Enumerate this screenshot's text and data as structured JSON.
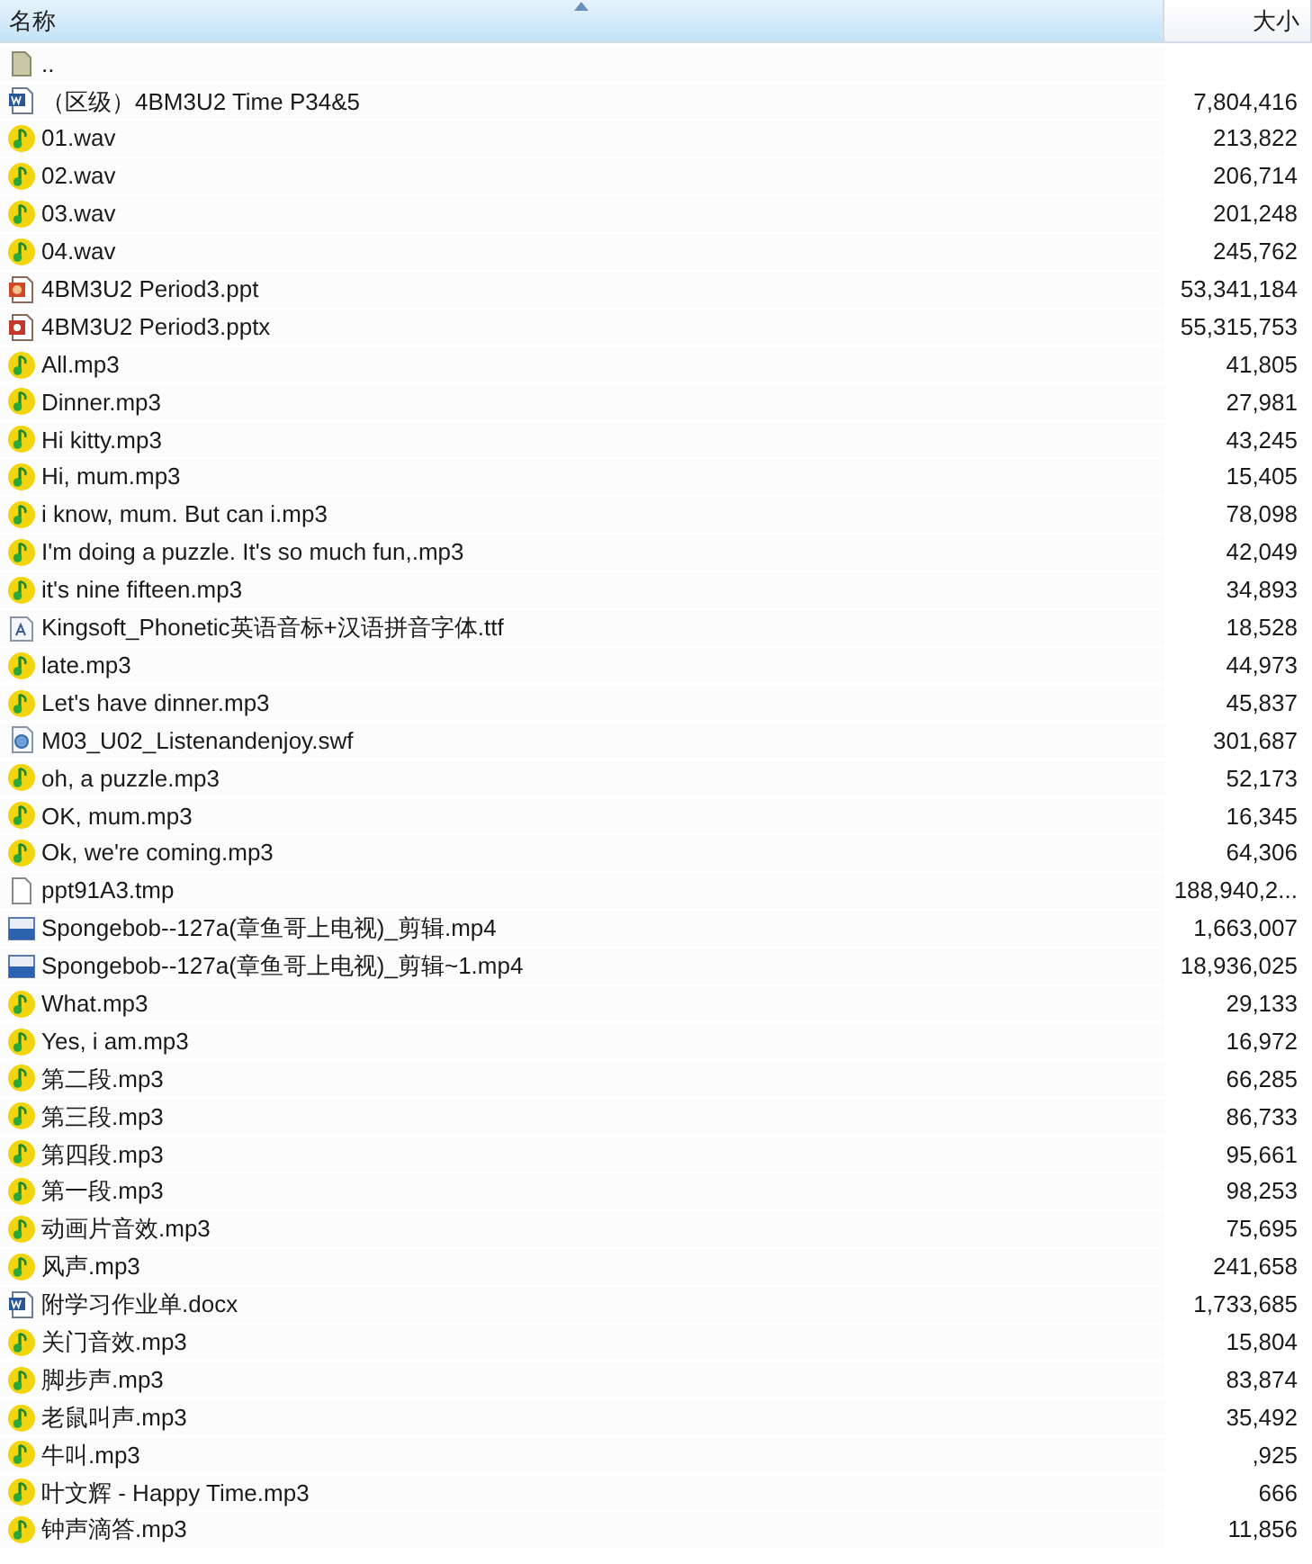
{
  "table": {
    "columns": [
      {
        "label": "名称",
        "sorted": true
      },
      {
        "label": "大小",
        "sorted": false
      }
    ],
    "rows": [
      {
        "kind": "folder",
        "name": "..",
        "size": ""
      },
      {
        "kind": "word",
        "name": "（区级）4BM3U2 Time P34&5",
        "size": "7,804,416"
      },
      {
        "kind": "audio",
        "name": "01.wav",
        "size": "213,822"
      },
      {
        "kind": "audio",
        "name": "02.wav",
        "size": "206,714"
      },
      {
        "kind": "audio",
        "name": "03.wav",
        "size": "201,248"
      },
      {
        "kind": "audio",
        "name": "04.wav",
        "size": "245,762"
      },
      {
        "kind": "ppt",
        "name": "4BM3U2 Period3.ppt",
        "size": "53,341,184"
      },
      {
        "kind": "pptx",
        "name": "4BM3U2 Period3.pptx",
        "size": "55,315,753"
      },
      {
        "kind": "audio",
        "name": "All.mp3",
        "size": "41,805"
      },
      {
        "kind": "audio",
        "name": "Dinner.mp3",
        "size": "27,981"
      },
      {
        "kind": "audio",
        "name": "Hi kitty.mp3",
        "size": "43,245"
      },
      {
        "kind": "audio",
        "name": "Hi, mum.mp3",
        "size": "15,405"
      },
      {
        "kind": "audio",
        "name": "i know, mum. But can i.mp3",
        "size": "78,098"
      },
      {
        "kind": "audio",
        "name": "I'm doing a puzzle. It's so much fun,.mp3",
        "size": "42,049"
      },
      {
        "kind": "audio",
        "name": "it's nine fifteen.mp3",
        "size": "34,893"
      },
      {
        "kind": "font",
        "name": "Kingsoft_Phonetic英语音标+汉语拼音字体.ttf",
        "size": "18,528"
      },
      {
        "kind": "audio",
        "name": "late.mp3",
        "size": "44,973"
      },
      {
        "kind": "audio",
        "name": "Let's have dinner.mp3",
        "size": "45,837"
      },
      {
        "kind": "swf",
        "name": "M03_U02_Listenandenjoy.swf",
        "size": "301,687"
      },
      {
        "kind": "audio",
        "name": "oh, a puzzle.mp3",
        "size": "52,173"
      },
      {
        "kind": "audio",
        "name": "OK, mum.mp3",
        "size": "16,345"
      },
      {
        "kind": "audio",
        "name": "Ok, we're coming.mp3",
        "size": "64,306"
      },
      {
        "kind": "blank",
        "name": "ppt91A3.tmp",
        "size": "188,940,2..."
      },
      {
        "kind": "video",
        "name": "Spongebob--127a(章鱼哥上电视)_剪辑.mp4",
        "size": "1,663,007"
      },
      {
        "kind": "video",
        "name": "Spongebob--127a(章鱼哥上电视)_剪辑~1.mp4",
        "size": "18,936,025"
      },
      {
        "kind": "audio",
        "name": "What.mp3",
        "size": "29,133"
      },
      {
        "kind": "audio",
        "name": "Yes, i am.mp3",
        "size": "16,972"
      },
      {
        "kind": "audio",
        "name": "第二段.mp3",
        "size": "66,285"
      },
      {
        "kind": "audio",
        "name": "第三段.mp3",
        "size": "86,733"
      },
      {
        "kind": "audio",
        "name": "第四段.mp3",
        "size": "95,661"
      },
      {
        "kind": "audio",
        "name": "第一段.mp3",
        "size": "98,253"
      },
      {
        "kind": "audio",
        "name": "动画片音效.mp3",
        "size": "75,695"
      },
      {
        "kind": "audio",
        "name": "风声.mp3",
        "size": "241,658"
      },
      {
        "kind": "word",
        "name": "附学习作业单.docx",
        "size": "1,733,685"
      },
      {
        "kind": "audio",
        "name": "关门音效.mp3",
        "size": "15,804"
      },
      {
        "kind": "audio",
        "name": "脚步声.mp3",
        "size": "83,874"
      },
      {
        "kind": "audio",
        "name": "老鼠叫声.mp3",
        "size": "35,492"
      },
      {
        "kind": "audio",
        "name": "牛叫.mp3",
        "size": ",925"
      },
      {
        "kind": "audio",
        "name": "叶文辉 - Happy Time.mp3",
        "size": "666"
      },
      {
        "kind": "audio",
        "name": "钟声滴答.mp3",
        "size": "11,856"
      }
    ]
  }
}
